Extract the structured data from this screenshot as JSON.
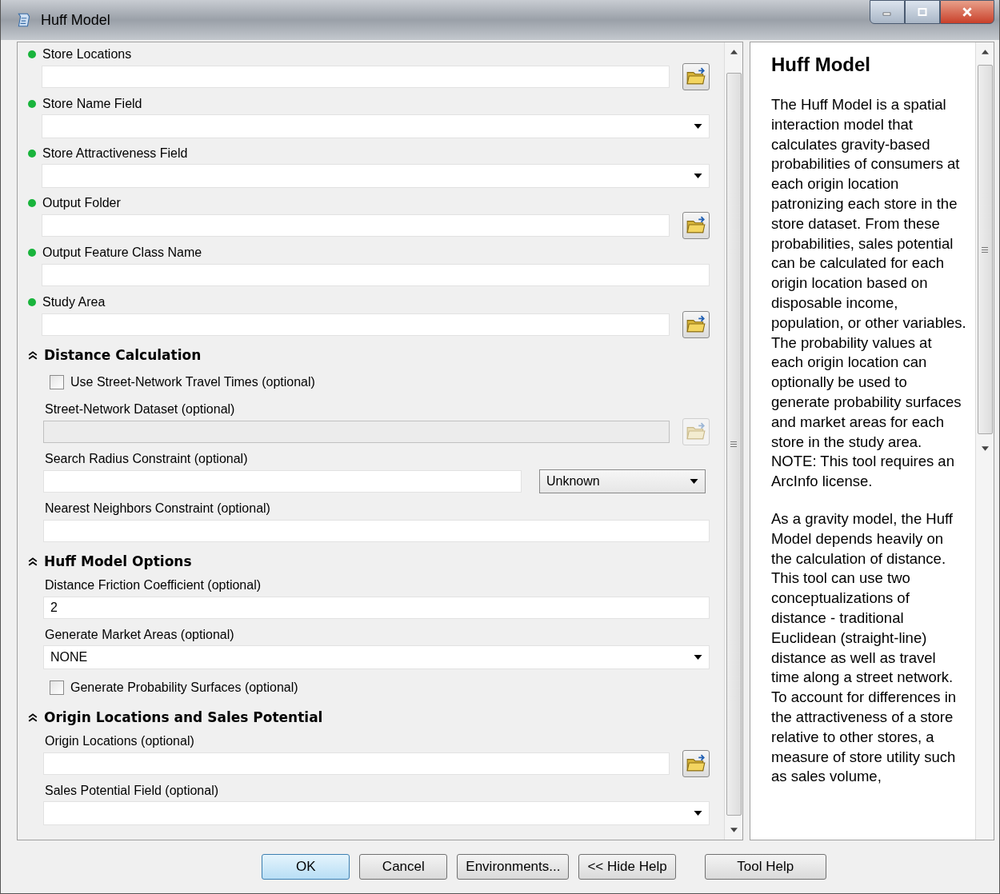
{
  "window": {
    "title": "Huff Model"
  },
  "form": [
    {
      "kind": "browse",
      "label": "Store Locations",
      "required": true,
      "disabled": false
    },
    {
      "kind": "dropdown",
      "label": "Store Name Field",
      "required": true
    },
    {
      "kind": "dropdown",
      "label": "Store Attractiveness Field",
      "required": true
    },
    {
      "kind": "browse",
      "label": "Output Folder",
      "required": true,
      "disabled": false
    },
    {
      "kind": "text",
      "label": "Output Feature Class Name",
      "required": true
    },
    {
      "kind": "browse",
      "label": "Study Area",
      "required": true,
      "disabled": false
    },
    {
      "kind": "section",
      "label": "Distance Calculation",
      "expanded": true
    },
    {
      "kind": "checkbox",
      "label": "Use Street-Network Travel Times (optional)",
      "checked": false
    },
    {
      "kind": "browse",
      "label": "Street-Network Dataset (optional)",
      "required": false,
      "disabled": true
    },
    {
      "kind": "linear_unit",
      "label": "Search Radius Constraint (optional)",
      "required": false,
      "unit": "Unknown"
    },
    {
      "kind": "text",
      "label": "Nearest Neighbors Constraint (optional)",
      "required": false
    },
    {
      "kind": "section",
      "label": "Huff Model Options",
      "expanded": true
    },
    {
      "kind": "text",
      "label": "Distance Friction Coefficient (optional)",
      "required": false,
      "value": "2"
    },
    {
      "kind": "dropdown",
      "label": "Generate Market Areas (optional)",
      "required": false,
      "value": "NONE"
    },
    {
      "kind": "checkbox",
      "label": "Generate Probability Surfaces (optional)",
      "checked": false
    },
    {
      "kind": "section",
      "label": "Origin Locations and Sales Potential",
      "expanded": true
    },
    {
      "kind": "browse",
      "label": "Origin Locations (optional)",
      "required": false,
      "disabled": false
    },
    {
      "kind": "dropdown",
      "label": "Sales Potential Field (optional)",
      "required": false
    }
  ],
  "help": {
    "title": "Huff Model",
    "paragraphs": [
      "The Huff Model is a spatial interaction model that calculates gravity-based probabilities of consumers at each origin location patronizing each store in the store dataset. From these probabilities, sales potential can be calculated for each origin location based on disposable income, population, or other variables. The probability values at each origin location can optionally be used to generate probability surfaces and market areas for each store in the study area. NOTE: This tool requires an ArcInfo license.",
      "As a gravity model, the Huff Model depends heavily on the calculation of distance. This tool can use two conceptualizations of distance - traditional Euclidean (straight-line) distance as well as travel time along a street network. To account for differences in the attractiveness of a store relative to other stores, a measure of store utility such as sales volume,"
    ]
  },
  "buttons": [
    {
      "label": "OK",
      "default": true
    },
    {
      "label": "Cancel",
      "default": false
    },
    {
      "label": "Environments...",
      "default": false
    },
    {
      "label": "<< Hide Help",
      "default": false
    },
    {
      "label": "Tool Help",
      "default": false
    }
  ]
}
